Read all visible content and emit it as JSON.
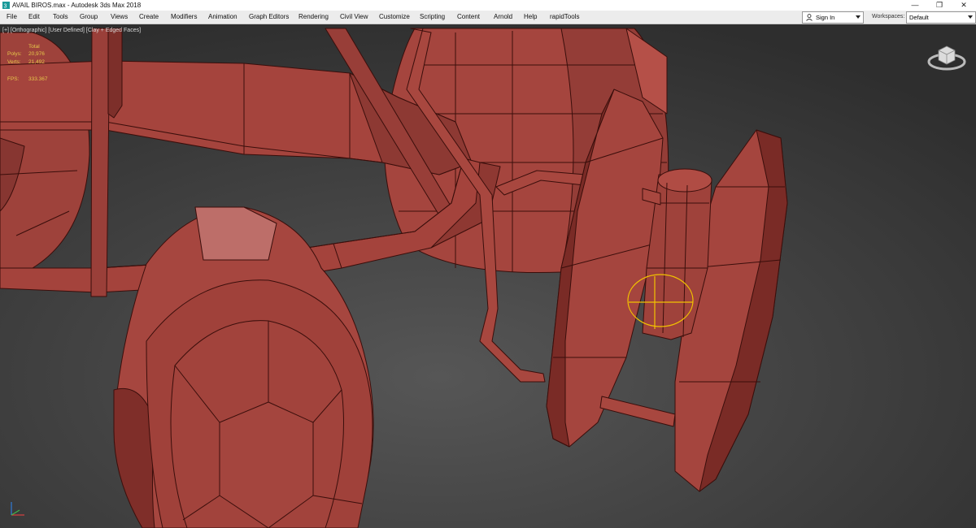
{
  "window": {
    "title": "AVAIL BIROS.max - Autodesk 3ds Max 2018",
    "minimize": "—",
    "restore": "❐",
    "close": "✕"
  },
  "menu": [
    "File",
    "Edit",
    "Tools",
    "Group",
    "Views",
    "Create",
    "Modifiers",
    "Animation",
    "Graph Editors",
    "Rendering",
    "Civil View",
    "Customize",
    "Scripting",
    "Content",
    "Arnold",
    "Help",
    "rapidTools"
  ],
  "account": {
    "sign_in": "Sign In"
  },
  "workspaces": {
    "label": "Workspaces:",
    "value": "Default"
  },
  "viewport": {
    "label": "[+] [Orthographic] [User Defined] [Clay + Edged Faces]",
    "stats_header": "Total",
    "polys_label": "Polys:",
    "polys_value": "20,976",
    "verts_label": "Verts:",
    "verts_value": "21,492",
    "fps_label": "FPS:",
    "fps_value": "333.367"
  },
  "colors": {
    "clay": "#a8463f",
    "clay_dark": "#7a2c27",
    "viewport_bg": "#3f3f3f",
    "stats": "#e6c84a"
  }
}
